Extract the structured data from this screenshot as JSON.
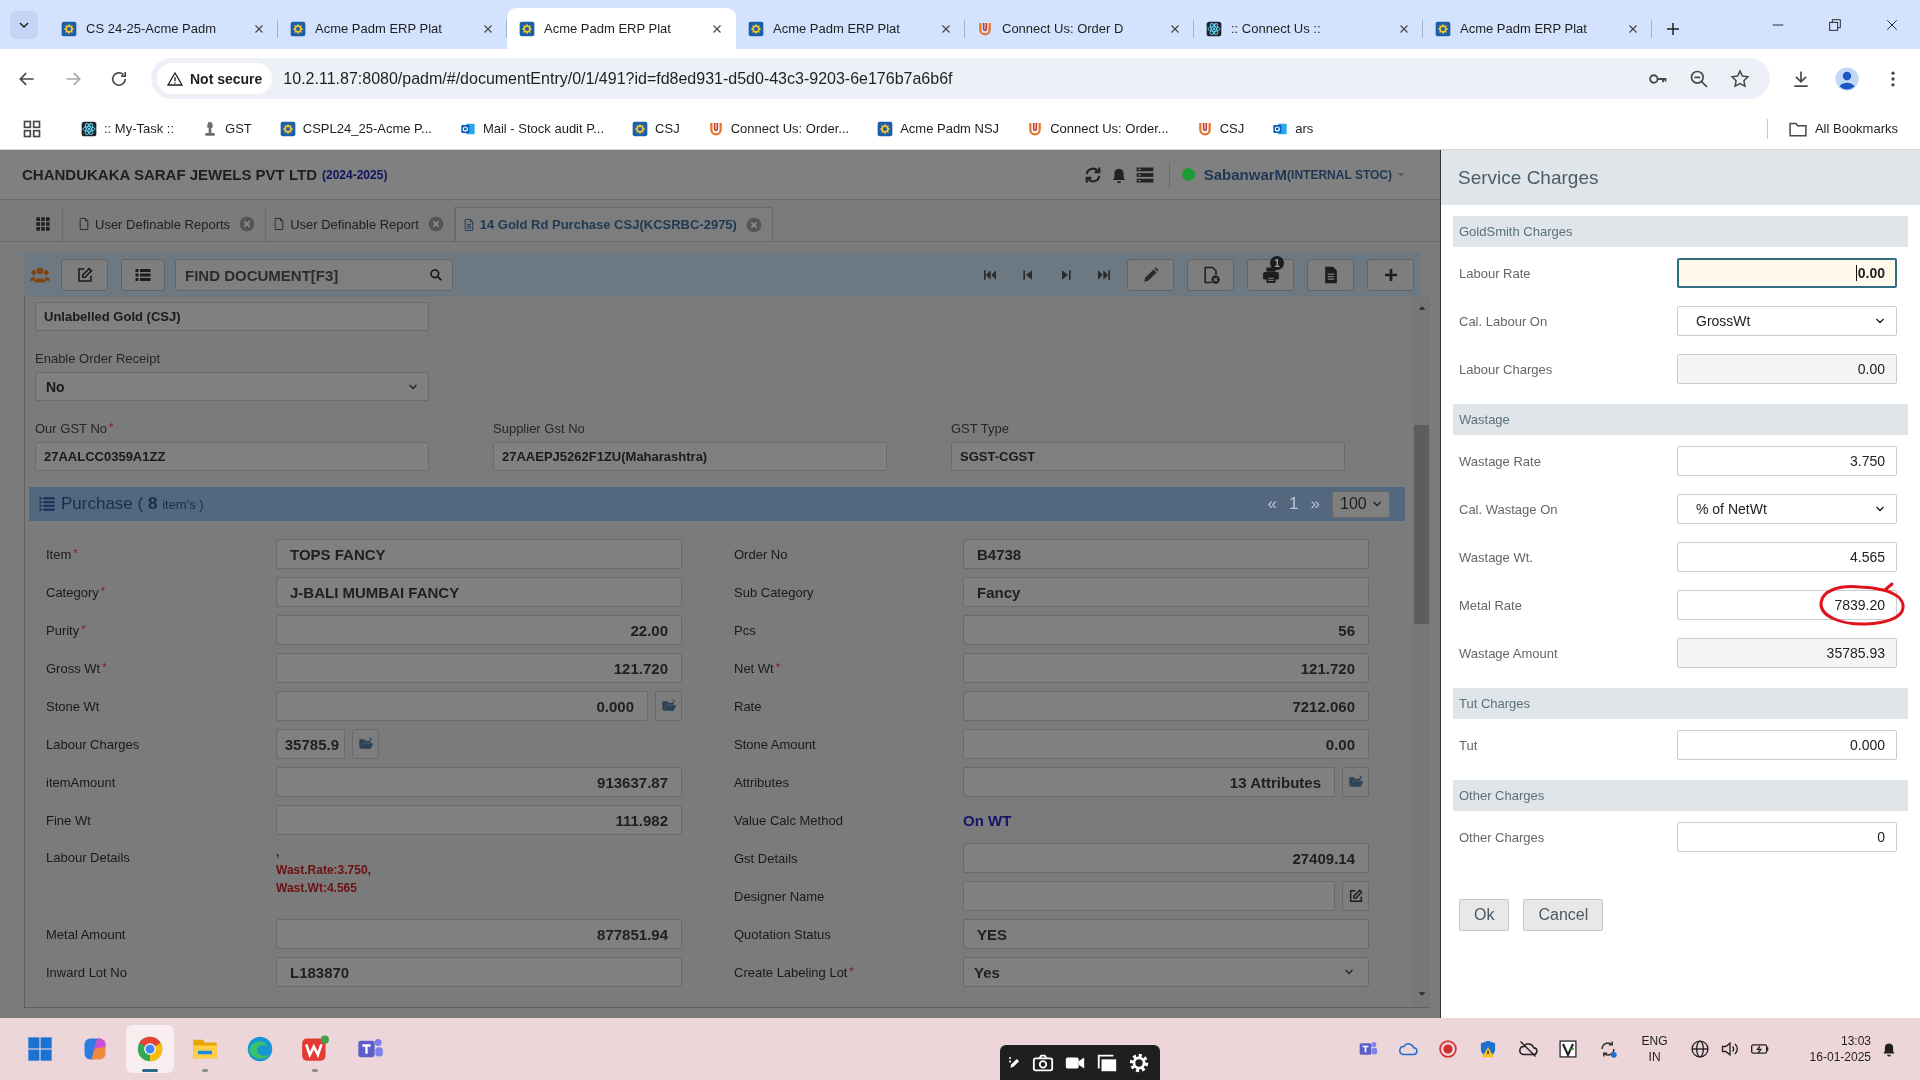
{
  "browser": {
    "tabs": [
      {
        "title": "CS 24-25-Acme Padm",
        "kind": "acme",
        "selected": false
      },
      {
        "title": "Acme Padm ERP Plat",
        "kind": "acme",
        "selected": false
      },
      {
        "title": "Acme Padm ERP Plat",
        "kind": "acme",
        "selected": true
      },
      {
        "title": "Acme Padm ERP Plat",
        "kind": "acme",
        "selected": false
      },
      {
        "title": "Connect Us: Order D",
        "kind": "connect",
        "selected": false
      },
      {
        "title": ":: Connect Us ::",
        "kind": "atom",
        "selected": false
      },
      {
        "title": "Acme Padm ERP Plat",
        "kind": "acme",
        "selected": false
      }
    ],
    "security": "Not secure",
    "url": "10.2.11.87:8080/padm/#/documentEntry/0/1/491?id=fd8ed931-d5d0-43c3-9203-6e176b7a6b6f",
    "bookmarks": [
      {
        "label": ":: My-Task ::",
        "kind": "atom"
      },
      {
        "label": "GST",
        "kind": "emblem"
      },
      {
        "label": "CSPL24_25-Acme P...",
        "kind": "acme"
      },
      {
        "label": "Mail - Stock audit P...",
        "kind": "outlook"
      },
      {
        "label": "CSJ",
        "kind": "acme"
      },
      {
        "label": "Connect Us: Order...",
        "kind": "connect"
      },
      {
        "label": "Acme Padm NSJ",
        "kind": "acme"
      },
      {
        "label": "Connect Us: Order...",
        "kind": "connect"
      },
      {
        "label": "CSJ",
        "kind": "connect"
      },
      {
        "label": "ars",
        "kind": "outlook"
      }
    ],
    "all_bookmarks": "All Bookmarks"
  },
  "app": {
    "company": "CHANDUKAKA SARAF JEWELS PVT LTD",
    "year": "(2024-2025)",
    "user": {
      "name": "SabanwarM",
      "role": "(INTERNAL STOC)",
      "online": true
    },
    "doc_tabs": [
      {
        "label": "User Definable Reports",
        "selected": false
      },
      {
        "label": "User Definable Report",
        "selected": false
      },
      {
        "label": "14 Gold Rd Purchase CSJ(KCSRBC-2975)",
        "selected": true
      }
    ],
    "find": {
      "placeholder": "FIND DOCUMENT[F3]"
    },
    "print_count": "1",
    "header_rows": [
      [
        {
          "kind": "text",
          "value": "Unlabelled Gold (CSJ)"
        }
      ],
      [
        {
          "kind": "select",
          "label": "Enable Order Receipt",
          "value": "No"
        }
      ],
      [
        {
          "kind": "text",
          "label": "Our GST No",
          "mark": "*",
          "value": "27AALCC0359A1ZZ"
        },
        {
          "kind": "text",
          "label": "Supplier Gst No",
          "value": "27AAEPJ5262F1ZU(Maharashtra)"
        },
        {
          "kind": "text",
          "label": "GST Type",
          "value": "SGST-CGST"
        }
      ]
    ],
    "purchase": {
      "title": "Purchase (",
      "count": "8",
      "unit": "item's )",
      "pager": {
        "prev": "«",
        "page": "1",
        "next": "»",
        "page_size": "100"
      },
      "left": [
        {
          "label": "Item",
          "mark": "*",
          "kind": "text",
          "value": "TOPS FANCY"
        },
        {
          "label": "Category",
          "mark": "*",
          "kind": "text",
          "value": "J-BALI MUMBAI FANCY"
        },
        {
          "label": "Purity",
          "mark": "*",
          "kind": "number",
          "value": "22.00"
        },
        {
          "label": "Gross Wt",
          "mark": "*",
          "kind": "number",
          "value": "121.720"
        },
        {
          "label": "Stone Wt",
          "kind": "number-folder",
          "value": "0.000"
        },
        {
          "label": "Labour Charges",
          "kind": "short-folder",
          "value": "35785.9"
        },
        {
          "label": "itemAmount",
          "kind": "number",
          "value": "913637.87"
        },
        {
          "label": "Fine Wt",
          "kind": "number",
          "value": "111.982"
        },
        {
          "label": "Labour Details",
          "kind": "note",
          "lines": [
            ",",
            "Wast.Rate:3.750,",
            "Wast.Wt:4.565"
          ]
        },
        {
          "label": "Metal Amount",
          "kind": "number",
          "value": "877851.94"
        },
        {
          "label": "Inward Lot No",
          "kind": "text",
          "value": "L183870"
        }
      ],
      "right": [
        {
          "label": "Order No",
          "kind": "text",
          "value": "B4738"
        },
        {
          "label": "Sub Category",
          "kind": "text",
          "value": "Fancy"
        },
        {
          "label": "Pcs",
          "kind": "number",
          "value": "56"
        },
        {
          "label": "Net Wt",
          "mark": "*",
          "kind": "number",
          "value": "121.720"
        },
        {
          "label": "Rate",
          "kind": "number",
          "value": "7212.060"
        },
        {
          "label": "Stone Amount",
          "kind": "number",
          "value": "0.00"
        },
        {
          "label": "Attributes",
          "kind": "number-folder",
          "value": "13 Attributes"
        },
        {
          "label": "Value Calc Method",
          "kind": "static",
          "value": "On WT"
        },
        {
          "label": "Gst Details",
          "kind": "number",
          "value": "27409.14"
        },
        {
          "label": "Designer Name",
          "kind": "edit"
        },
        {
          "label": "Quotation Status",
          "kind": "text",
          "value": "YES"
        },
        {
          "label": "Create Labeling Lot",
          "mark": "*",
          "kind": "select",
          "value": "Yes"
        }
      ]
    }
  },
  "service_charges": {
    "title": "Service Charges",
    "sections": [
      {
        "heading": "GoldSmith Charges",
        "rows": [
          {
            "label": "Labour Rate",
            "kind": "input",
            "value": "0.00",
            "focused": true,
            "circled": false
          },
          {
            "label": "Cal. Labour On",
            "kind": "select",
            "value": "GrossWt",
            "focused": false,
            "circled": false
          },
          {
            "label": "Labour Charges",
            "kind": "readonly",
            "value": "0.00",
            "focused": false,
            "circled": false
          }
        ]
      },
      {
        "heading": "Wastage",
        "rows": [
          {
            "label": "Wastage Rate",
            "kind": "input",
            "value": "3.750",
            "focused": false,
            "circled": false
          },
          {
            "label": "Cal. Wastage On",
            "kind": "select",
            "value": "% of NetWt",
            "focused": false,
            "circled": false
          },
          {
            "label": "Wastage Wt.",
            "kind": "input",
            "value": "4.565",
            "focused": false,
            "circled": false
          },
          {
            "label": "Metal Rate",
            "kind": "input",
            "value": "7839.20",
            "focused": false,
            "circled": true
          },
          {
            "label": "Wastage Amount",
            "kind": "readonly",
            "value": "35785.93",
            "focused": false,
            "circled": false
          }
        ]
      },
      {
        "heading": "Tut Charges",
        "rows": [
          {
            "label": "Tut",
            "kind": "input",
            "value": "0.000",
            "focused": false,
            "circled": false
          }
        ]
      },
      {
        "heading": "Other Charges",
        "rows": [
          {
            "label": "Other Charges",
            "kind": "input",
            "value": "0",
            "focused": false,
            "circled": false
          }
        ]
      }
    ],
    "buttons": [
      "Ok",
      "Cancel"
    ]
  },
  "taskbar": {
    "apps": [
      {
        "kind": "start",
        "selected": false,
        "running": false
      },
      {
        "kind": "copilot",
        "selected": false,
        "running": false
      },
      {
        "kind": "chrome",
        "selected": true,
        "running": true
      },
      {
        "kind": "explorer",
        "selected": false,
        "running": true
      },
      {
        "kind": "edge",
        "selected": false,
        "running": false
      },
      {
        "kind": "wps",
        "selected": false,
        "running": true
      },
      {
        "kind": "teams",
        "selected": false,
        "running": false
      }
    ],
    "capture_tools": [
      {
        "kind": "pen"
      },
      {
        "kind": "camera"
      },
      {
        "kind": "video"
      },
      {
        "kind": "window"
      },
      {
        "kind": "gear"
      }
    ],
    "tray": [
      {
        "kind": "teams"
      },
      {
        "kind": "onedrive"
      },
      {
        "kind": "record"
      },
      {
        "kind": "shield"
      },
      {
        "kind": "cloud-off"
      },
      {
        "kind": "v-app"
      },
      {
        "kind": "sync"
      }
    ],
    "language": "ENG",
    "region": "IN",
    "status_icons": [
      {
        "kind": "globe"
      },
      {
        "kind": "speaker"
      },
      {
        "kind": "battery"
      }
    ],
    "time": "13:03",
    "date": "16-01-2025"
  }
}
